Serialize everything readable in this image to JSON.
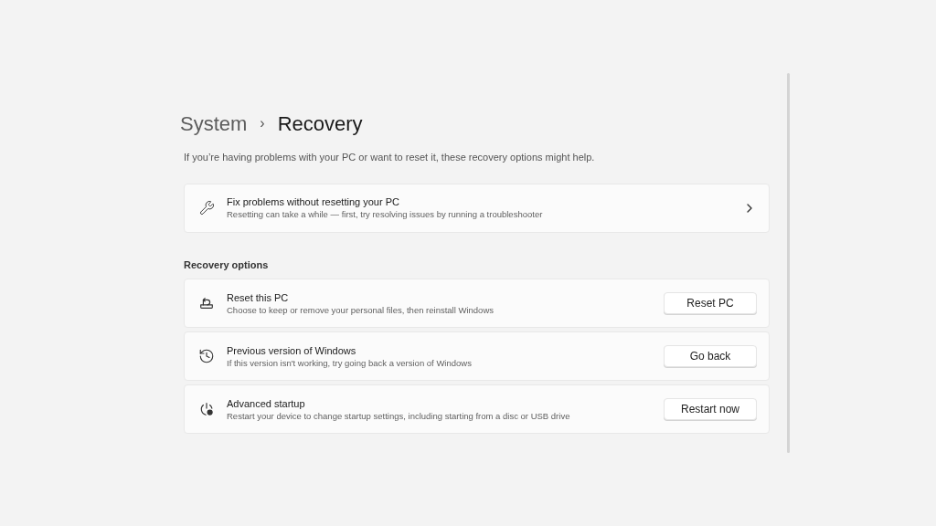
{
  "breadcrumb": {
    "parent": "System",
    "separator": "›",
    "current": "Recovery"
  },
  "description": "If you’re having problems with your PC or want to reset it, these recovery options might help.",
  "cards": [
    {
      "kind": "link",
      "title": "Fix problems without resetting your PC",
      "subtitle": "Resetting can take a while — first, try resolving issues by running a troubleshooter"
    }
  ],
  "section": {
    "title": "Recovery options",
    "items": [
      {
        "kind": "button",
        "title": "Reset this PC",
        "subtitle": "Choose to keep or remove your personal files, then reinstall Windows",
        "button": "Reset PC"
      },
      {
        "kind": "button",
        "title": "Previous version of Windows",
        "subtitle": "If this version isn't working, try going back a version of Windows",
        "button": "Go back"
      },
      {
        "kind": "button",
        "title": "Advanced startup",
        "subtitle": "Restart your device to change startup settings, including starting from a disc or USB drive",
        "button": "Restart now"
      }
    ]
  }
}
